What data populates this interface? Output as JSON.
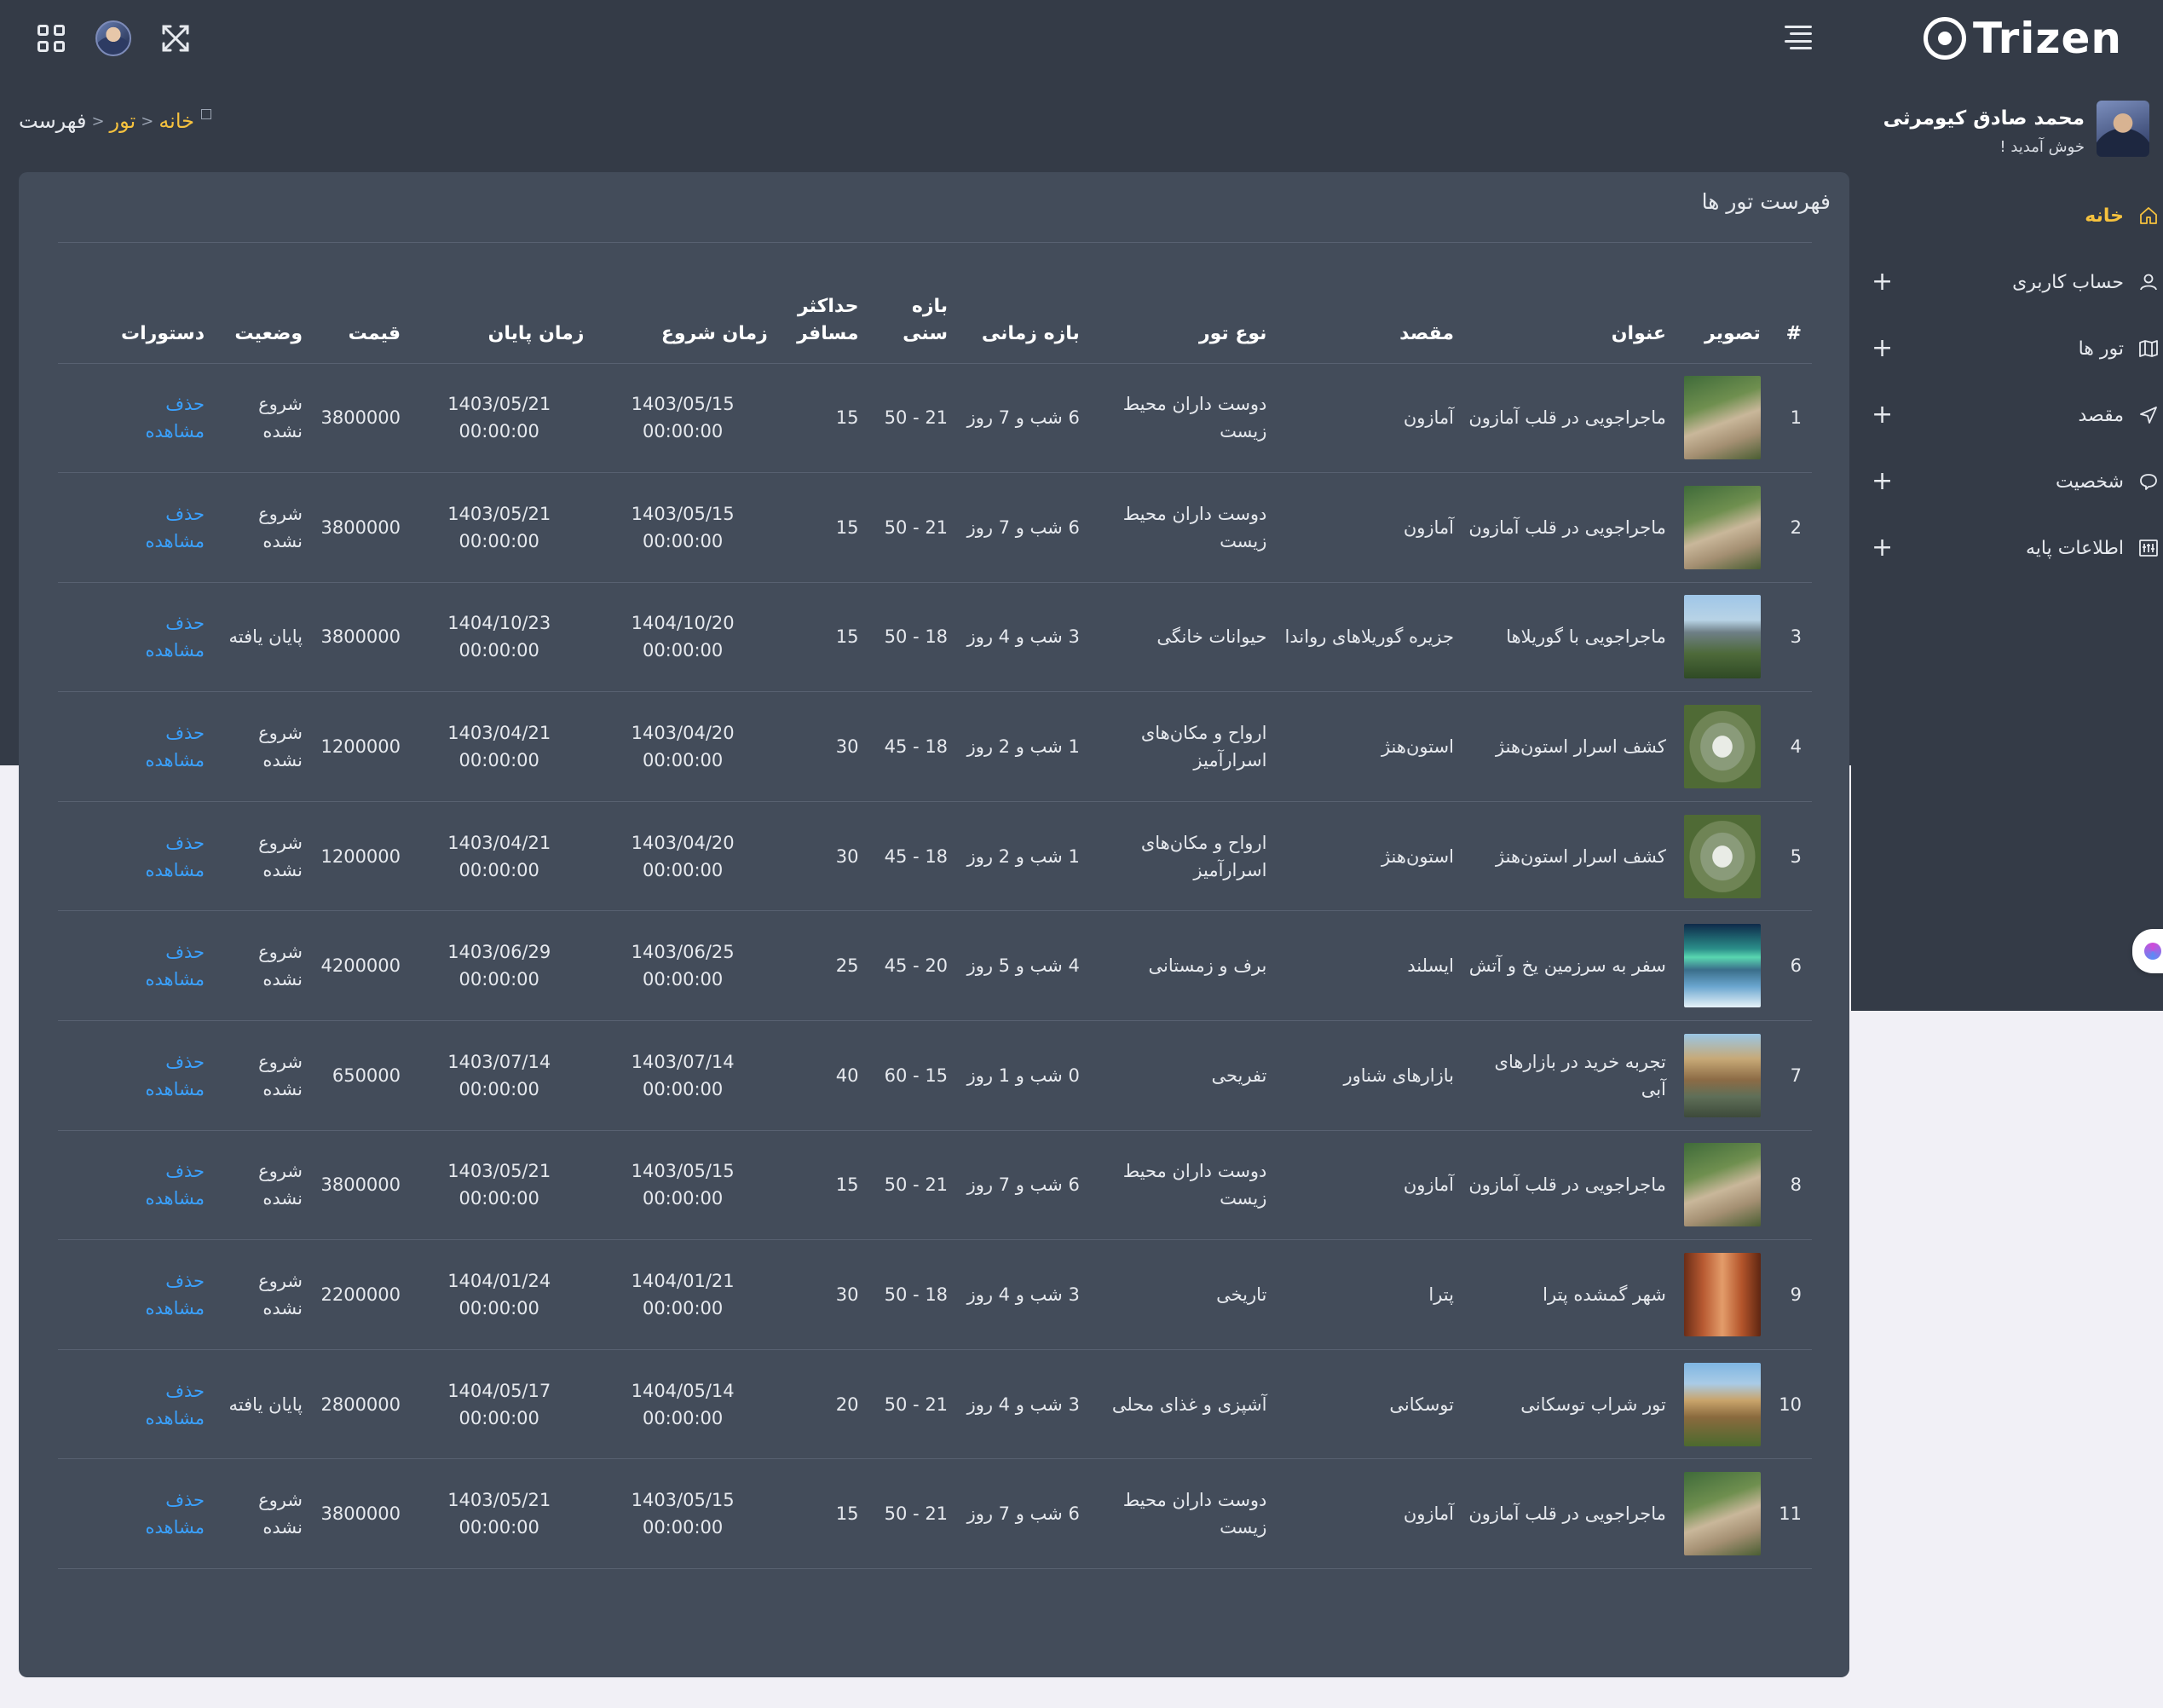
{
  "brand": {
    "name": "Trizen"
  },
  "user": {
    "name": "محمد صادق کیومرثی",
    "welcome": "خوش آمدید !"
  },
  "sidebar": {
    "items": [
      {
        "label": "خانه",
        "icon": "home-icon",
        "active": true,
        "expandable": false
      },
      {
        "label": "حساب کاربری",
        "icon": "user-icon",
        "active": false,
        "expandable": true
      },
      {
        "label": "تور ها",
        "icon": "map-icon",
        "active": false,
        "expandable": true
      },
      {
        "label": "مقصد",
        "icon": "send-icon",
        "active": false,
        "expandable": true
      },
      {
        "label": "شخصیت",
        "icon": "chat-icon",
        "active": false,
        "expandable": true
      },
      {
        "label": "اطلاعات پایه",
        "icon": "settings-sliders-icon",
        "active": false,
        "expandable": true
      }
    ],
    "plus": "+"
  },
  "breadcrumb": {
    "home": "خانه",
    "sep": ">",
    "tour": "تور",
    "current": "فهرست"
  },
  "card": {
    "title": "فهرست تور ها"
  },
  "table": {
    "headers": {
      "num": "#",
      "image": "تصویر",
      "title": "عنوان",
      "destination": "مقصد",
      "type": "نوع تور",
      "duration": "بازه زمانی",
      "age": "بازه سنی",
      "max": "حداکثر مسافر",
      "start": "زمان شروع",
      "end": "زمان پایان",
      "price": "قیمت",
      "status": "وضعیت",
      "actions": "دستورات"
    },
    "rows": [
      {
        "num": "1",
        "img": "amazon",
        "title": "ماجراجویی در قلب آمازون",
        "destination": "آمازون",
        "type": "دوست داران محیط زیست",
        "duration": "6 شب و 7 روز",
        "age": "21 - 50",
        "max": "15",
        "start_date": "1403/05/15",
        "start_time": "00:00:00",
        "end_date": "1403/05/21",
        "end_time": "00:00:00",
        "price": "3800000",
        "status": "شروع نشده",
        "delete": "حذف",
        "view": "مشاهده"
      },
      {
        "num": "2",
        "img": "amazon",
        "title": "ماجراجویی در قلب آمازون",
        "destination": "آمازون",
        "type": "دوست داران محیط زیست",
        "duration": "6 شب و 7 روز",
        "age": "21 - 50",
        "max": "15",
        "start_date": "1403/05/15",
        "start_time": "00:00:00",
        "end_date": "1403/05/21",
        "end_time": "00:00:00",
        "price": "3800000",
        "status": "شروع نشده",
        "delete": "حذف",
        "view": "مشاهده"
      },
      {
        "num": "3",
        "img": "gorilla",
        "title": "ماجراجویی با گوریلاها",
        "destination": "جزیره گوریلاهای رواندا",
        "type": "حیوانات خانگی",
        "duration": "3 شب و 4 روز",
        "age": "18 - 50",
        "max": "15",
        "start_date": "1404/10/20",
        "start_time": "00:00:00",
        "end_date": "1404/10/23",
        "end_time": "00:00:00",
        "price": "3800000",
        "status": "پایان یافته",
        "delete": "حذف",
        "view": "مشاهده"
      },
      {
        "num": "4",
        "img": "stonehenge",
        "title": "کشف اسرار استون‌هنژ",
        "destination": "استون‌هنژ",
        "type": "ارواح و مکان‌های اسرارآمیز",
        "duration": "1 شب و 2 روز",
        "age": "18 - 45",
        "max": "30",
        "start_date": "1403/04/20",
        "start_time": "00:00:00",
        "end_date": "1403/04/21",
        "end_time": "00:00:00",
        "price": "1200000",
        "status": "شروع نشده",
        "delete": "حذف",
        "view": "مشاهده"
      },
      {
        "num": "5",
        "img": "stonehenge",
        "title": "کشف اسرار استون‌هنژ",
        "destination": "استون‌هنژ",
        "type": "ارواح و مکان‌های اسرارآمیز",
        "duration": "1 شب و 2 روز",
        "age": "18 - 45",
        "max": "30",
        "start_date": "1403/04/20",
        "start_time": "00:00:00",
        "end_date": "1403/04/21",
        "end_time": "00:00:00",
        "price": "1200000",
        "status": "شروع نشده",
        "delete": "حذف",
        "view": "مشاهده"
      },
      {
        "num": "6",
        "img": "iceland",
        "title": "سفر به سرزمین یخ و آتش",
        "destination": "ایسلند",
        "type": "برف و زمستانی",
        "duration": "4 شب و 5 روز",
        "age": "20 - 45",
        "max": "25",
        "start_date": "1403/06/25",
        "start_time": "00:00:00",
        "end_date": "1403/06/29",
        "end_time": "00:00:00",
        "price": "4200000",
        "status": "شروع نشده",
        "delete": "حذف",
        "view": "مشاهده"
      },
      {
        "num": "7",
        "img": "market",
        "title": "تجربه خرید در بازارهای آبی",
        "destination": "بازارهای شناور",
        "type": "تفریحی",
        "duration": "0 شب و 1 روز",
        "age": "15 - 60",
        "max": "40",
        "start_date": "1403/07/14",
        "start_time": "00:00:00",
        "end_date": "1403/07/14",
        "end_time": "00:00:00",
        "price": "650000",
        "status": "شروع نشده",
        "delete": "حذف",
        "view": "مشاهده"
      },
      {
        "num": "8",
        "img": "amazon",
        "title": "ماجراجویی در قلب آمازون",
        "destination": "آمازون",
        "type": "دوست داران محیط زیست",
        "duration": "6 شب و 7 روز",
        "age": "21 - 50",
        "max": "15",
        "start_date": "1403/05/15",
        "start_time": "00:00:00",
        "end_date": "1403/05/21",
        "end_time": "00:00:00",
        "price": "3800000",
        "status": "شروع نشده",
        "delete": "حذف",
        "view": "مشاهده"
      },
      {
        "num": "9",
        "img": "petra",
        "title": "شهر گمشده پترا",
        "destination": "پترا",
        "type": "تاریخی",
        "duration": "3 شب و 4 روز",
        "age": "18 - 50",
        "max": "30",
        "start_date": "1404/01/21",
        "start_time": "00:00:00",
        "end_date": "1404/01/24",
        "end_time": "00:00:00",
        "price": "2200000",
        "status": "شروع نشده",
        "delete": "حذف",
        "view": "مشاهده"
      },
      {
        "num": "10",
        "img": "tuscany",
        "title": "تور شراب توسکانی",
        "destination": "توسکانی",
        "type": "آشپزی و غذای محلی",
        "duration": "3 شب و 4 روز",
        "age": "21 - 50",
        "max": "20",
        "start_date": "1404/05/14",
        "start_time": "00:00:00",
        "end_date": "1404/05/17",
        "end_time": "00:00:00",
        "price": "2800000",
        "status": "پایان یافته",
        "delete": "حذف",
        "view": "مشاهده"
      },
      {
        "num": "11",
        "img": "amazon",
        "title": "ماجراجویی در قلب آمازون",
        "destination": "آمازون",
        "type": "دوست داران محیط زیست",
        "duration": "6 شب و 7 روز",
        "age": "21 - 50",
        "max": "15",
        "start_date": "1403/05/15",
        "start_time": "00:00:00",
        "end_date": "1403/05/21",
        "end_time": "00:00:00",
        "price": "3800000",
        "status": "شروع نشده",
        "delete": "حذف",
        "view": "مشاهده"
      }
    ]
  },
  "colors": {
    "topbar": "#343b47",
    "card": "#434c5a",
    "accent": "#f6c23e",
    "link": "#3aa1ff",
    "page": "#f1f0f6"
  },
  "images": {
    "amazon": "linear-gradient(160deg,#3f6b3a 0%,#6f8f4f 35%,#c9b79a 55%,#a48f72 75%,#4a5e33 100%)",
    "gorilla": "linear-gradient(180deg,#9fc6e8 0%,#b8d3e6 30%,#6e7f86 45%,#4e6a3a 70%,#2f4a25 100%)",
    "stonehenge": "radial-gradient(ellipse at 50% 50%,#e9ece6 0 18%,#8a9b7a 19% 40%,#6f8455 41% 60%,#4f6a35 61%)",
    "iceland": "linear-gradient(180deg,#0e2a4a 0%,#2b8f8a 30%,#59d6b0 40%,#3a6e8a 55%,#6aa6cf 75%,#e6f2f8 100%)",
    "market": "linear-gradient(180deg,#9ac6e4 0%,#c7a977 30%,#8c6b45 55%,#5f6f58 75%,#3d4a3a 100%)",
    "petra": "linear-gradient(90deg,#6b2d17 0%,#b85a32 25%,#e39c6a 50%,#b4552b 75%,#5e2612 100%)",
    "tuscany": "linear-gradient(180deg,#7fb6e3 0%,#a9cbe6 25%,#c9a46b 45%,#8a6a3e 65%,#4c6a2e 100%)"
  }
}
